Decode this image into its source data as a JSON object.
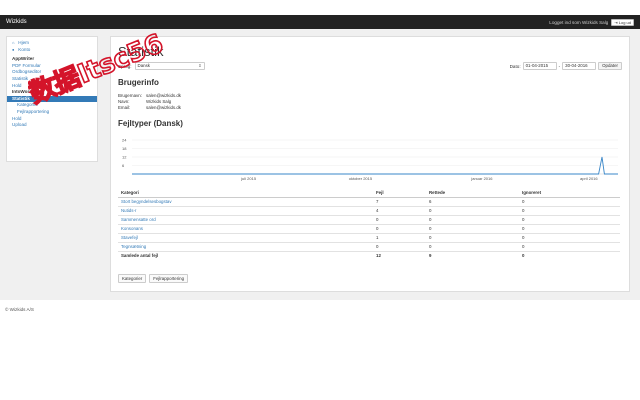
{
  "topbar": {
    "brand": "Wizkids",
    "logged_in_text": "Logget ind som Wizkids Salg",
    "logout_label": "Log ud"
  },
  "sidebar": {
    "items": [
      {
        "label": "Hjem",
        "icon": "home-icon"
      },
      {
        "label": "Konto",
        "icon": "user-icon"
      }
    ],
    "section_header": "AppWriter",
    "section_items": [
      "PDF Formular",
      "Ordbogseditor",
      "Statistik",
      "Hold"
    ],
    "section2_header": "IntoWords",
    "active_item": "Statistik",
    "sub_items": [
      "Kategorier",
      "Fejlrapportering"
    ],
    "bottom_items": [
      "Hold",
      "Upload"
    ]
  },
  "main": {
    "title": "Statistik",
    "language_label": "Sprog:",
    "language_value": "Dansk",
    "date_label": "Dato:",
    "date_from": "01-04-2015",
    "date_separator": "-",
    "date_to": "30-04-2016",
    "update_label": "Opdater",
    "userinfo_title": "Brugerinfo",
    "userinfo": [
      {
        "label": "Brugernavn:",
        "value": "salen@wizkids.dk"
      },
      {
        "label": "Navn:",
        "value": "Wizkids Salg"
      },
      {
        "label": "Email:",
        "value": "salen@wizkids.dk"
      }
    ],
    "errortypes_title": "Fejltyper (Dansk)"
  },
  "chart_data": {
    "type": "line",
    "x_ticks": [
      "juli 2015",
      "oktober 2015",
      "januar 2016",
      "april 2016"
    ],
    "y_ticks": [
      24,
      18,
      12,
      6
    ],
    "ylim": [
      0,
      24
    ],
    "grid": true,
    "series": [
      {
        "points": [
          [
            0,
            0
          ],
          [
            0.96,
            0
          ],
          [
            0.967,
            12
          ],
          [
            0.972,
            0
          ],
          [
            1,
            0
          ]
        ]
      }
    ]
  },
  "table": {
    "headers": [
      "Kategori",
      "Fejl",
      "Rettede",
      "Ignoreret"
    ],
    "rows": [
      [
        "Stort begyndelsesbogstav",
        "7",
        "6",
        "0"
      ],
      [
        "Nutids-r",
        "4",
        "0",
        "0"
      ],
      [
        "Sammensatte ord",
        "0",
        "0",
        "0"
      ],
      [
        "Konsonans",
        "0",
        "0",
        "0"
      ],
      [
        "Stavefejl",
        "1",
        "0",
        "0"
      ],
      [
        "Tegnsætning",
        "0",
        "0",
        "0"
      ]
    ],
    "total": [
      "Samlede antal fejl",
      "12",
      "9",
      "0"
    ]
  },
  "buttons": {
    "categories_label": "Kategorier",
    "error_report_label": "Fejlrapportering"
  },
  "footer": {
    "copyright": "© Wizkids A/S"
  },
  "watermark": {
    "text": "数据Itsc56"
  },
  "colors": {
    "topbar": "#222222",
    "accent": "#337ab7",
    "chart_line": "#3a87c8",
    "watermark": "#d4142a"
  }
}
